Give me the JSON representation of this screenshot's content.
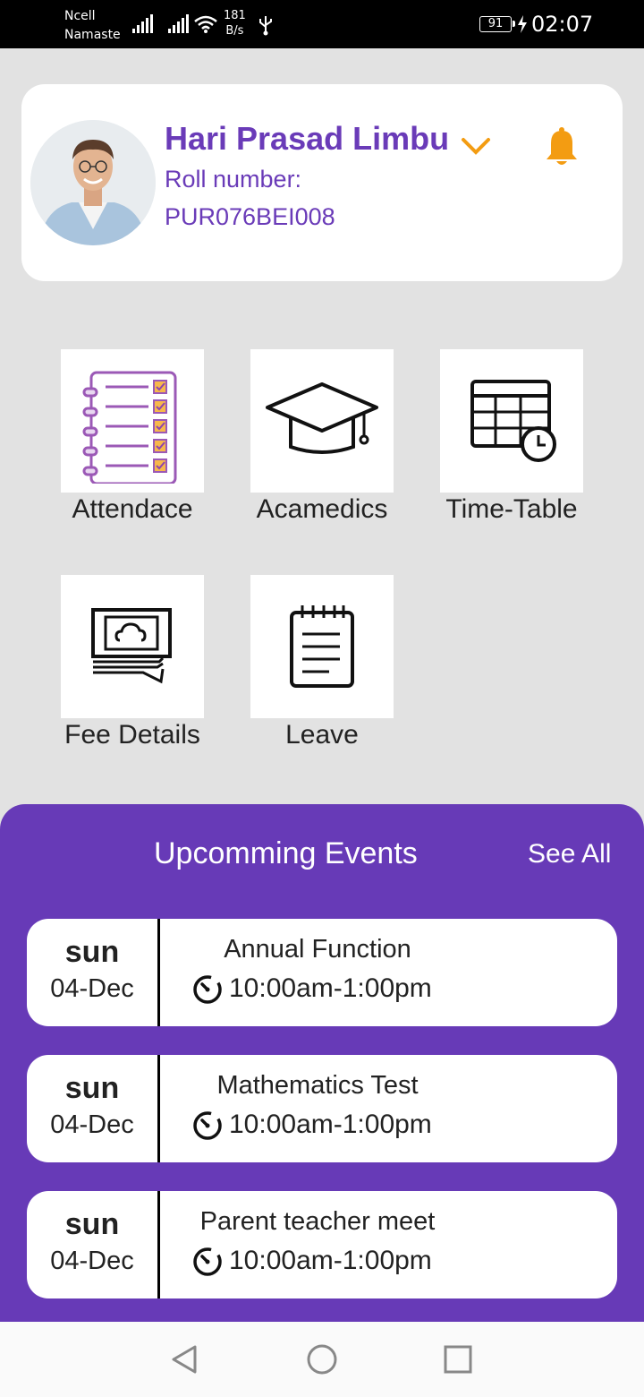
{
  "status_bar": {
    "carrier_1": "Ncell",
    "carrier_2": "Namaste",
    "speed_value": "181",
    "speed_unit": "B/s",
    "battery": "91",
    "time": "02:07"
  },
  "profile": {
    "name": "Hari Prasad Limbu",
    "roll_label": "Roll number:",
    "roll_value": "PUR076BEI008"
  },
  "menu": {
    "attendance": "Attendace",
    "academics": "Acamedics",
    "timetable": "Time-Table",
    "fee": "Fee Details",
    "leave": "Leave"
  },
  "events": {
    "title": "Upcomming Events",
    "see_all": "See All",
    "items": [
      {
        "day": "sun",
        "date": "04-Dec",
        "name": "Annual Function",
        "time": "10:00am-1:00pm"
      },
      {
        "day": "sun",
        "date": "04-Dec",
        "name": "Mathematics Test",
        "time": "10:00am-1:00pm"
      },
      {
        "day": "sun",
        "date": "04-Dec",
        "name": "Parent teacher meet",
        "time": "10:00am-1:00pm"
      }
    ]
  },
  "colors": {
    "primary": "#673ab7",
    "accent": "#f39c12",
    "background": "#e2e2e2"
  },
  "icons": {
    "notification": "bell-icon",
    "expand": "chevron-down-icon",
    "event_time": "timer-icon"
  }
}
